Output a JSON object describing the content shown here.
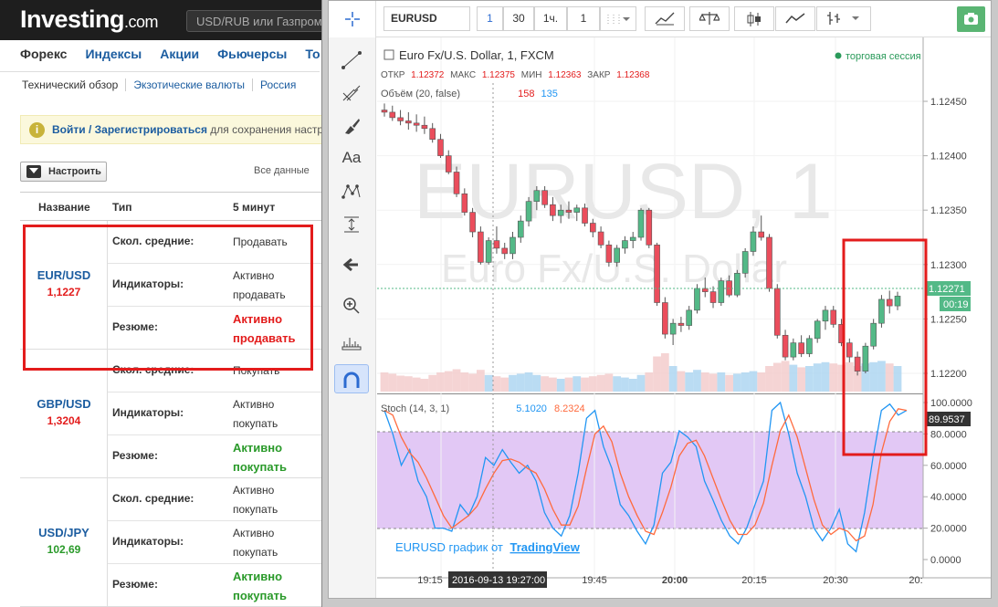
{
  "site": {
    "logo_main": "Investing",
    "logo_suffix": ".com",
    "search_placeholder": "USD/RUB или Газпром",
    "nav": [
      "Форекс",
      "Индексы",
      "Акции",
      "Фьючерсы",
      "То"
    ],
    "sub_nav": [
      "Технический обзор",
      "Экзотические валюты",
      "Россия"
    ],
    "banner": {
      "login": "Войти",
      "sep": " / ",
      "register": "Зарегистрироваться",
      "rest": " для сохранения настр"
    },
    "configure_label": "Настроить",
    "all_data_label": "Все данные",
    "table_headers": {
      "name": "Название",
      "type": "Тип",
      "interval": "5 минут"
    },
    "pairs": [
      {
        "name": "EUR/USD",
        "price": "1,1227",
        "price_color": "#e31c1c",
        "rows": [
          {
            "label": "Скол. средние:",
            "value": "Продавать"
          },
          {
            "label": "Индикаторы:",
            "value": "Активно продавать"
          },
          {
            "label": "Резюме:",
            "value": "Активно продавать"
          }
        ]
      },
      {
        "name": "GBP/USD",
        "price": "1,3204",
        "price_color": "#e31c1c",
        "rows": [
          {
            "label": "Скол. средние:",
            "value": "Покупать"
          },
          {
            "label": "Индикаторы:",
            "value": "Активно покупать"
          },
          {
            "label": "Резюме:",
            "value": "Активно покупать"
          }
        ]
      },
      {
        "name": "USD/JPY",
        "price": "102,69",
        "price_color": "#2a9a2a",
        "rows": [
          {
            "label": "Скол. средние:",
            "value": "Активно покупать"
          },
          {
            "label": "Индикаторы:",
            "value": "Активно покупать"
          },
          {
            "label": "Резюме:",
            "value": "Активно покупать"
          }
        ]
      }
    ]
  },
  "chart_window": {
    "symbol": "EURUSD",
    "intervals": [
      "1",
      "30",
      "1ч.",
      "1"
    ],
    "legend": {
      "title": "Euro Fx/U.S. Dollar, 1, FXCM",
      "open_prefix": "ОТКР",
      "open": "1.12372",
      "high_label": "МАКС",
      "high": "1.12375",
      "low_label": "МИН",
      "low": "1.12363",
      "close_label": "ЗАКР",
      "close": "1.12368"
    },
    "session_label": "торговая сессия",
    "volume_label": "Объём (20, false)",
    "volume_values": [
      "158",
      "135"
    ],
    "watermark_symbol": "EURUSD, 1",
    "watermark_name": "Euro Fx/U.S. Dollar",
    "stoch_label": "Stoch (14, 3, 1)",
    "stoch_values": [
      "5.1020",
      "8.2324"
    ],
    "attribution_prefix": "EURUSD график от",
    "attribution_link": "TradingView",
    "price_axis": [
      "1.12450",
      "1.12400",
      "1.12350",
      "1.12300",
      "1.12250",
      "1.12200"
    ],
    "current_price": "1.12271",
    "countdown": "00:19",
    "stoch_axis": [
      "100.0000",
      "80.0000",
      "60.0000",
      "40.0000",
      "20.0000",
      "0.0000"
    ],
    "stoch_current": "89.9537",
    "time_axis": [
      "19:15",
      "19:45",
      "20:00",
      "20:15",
      "20:30",
      "20:"
    ],
    "crosshair_time": "2016-09-13 19:27:00",
    "colors": {
      "up": "#53b987",
      "down": "#eb4d5c",
      "stoch_k": "#2196f3",
      "stoch_d": "#ff6a3d",
      "band": "#e2c8f5"
    }
  },
  "chart_data": [
    {
      "type": "candlestick",
      "title": "Euro Fx/U.S. Dollar, 1, FXCM",
      "ylim": [
        1.1218,
        1.1247
      ],
      "candles": [
        [
          1.12442,
          1.12448,
          1.12436,
          1.1244
        ],
        [
          1.1244,
          1.12446,
          1.12432,
          1.12435
        ],
        [
          1.12435,
          1.12442,
          1.12428,
          1.12432
        ],
        [
          1.12432,
          1.1244,
          1.12424,
          1.1243
        ],
        [
          1.1243,
          1.12438,
          1.12422,
          1.12428
        ],
        [
          1.12428,
          1.12436,
          1.1242,
          1.12425
        ],
        [
          1.12425,
          1.1243,
          1.12412,
          1.12415
        ],
        [
          1.12415,
          1.1242,
          1.12398,
          1.124
        ],
        [
          1.124,
          1.12405,
          1.12383,
          1.12385
        ],
        [
          1.12385,
          1.1239,
          1.12362,
          1.12365
        ],
        [
          1.12365,
          1.1237,
          1.12345,
          1.12348
        ],
        [
          1.12348,
          1.12352,
          1.12325,
          1.1233
        ],
        [
          1.1233,
          1.12335,
          1.123,
          1.12302
        ],
        [
          1.12302,
          1.12325,
          1.123,
          1.12322
        ],
        [
          1.12322,
          1.12335,
          1.1231,
          1.12315
        ],
        [
          1.12315,
          1.1232,
          1.12305,
          1.1231
        ],
        [
          1.1231,
          1.1233,
          1.12305,
          1.12325
        ],
        [
          1.12325,
          1.12345,
          1.1232,
          1.1234
        ],
        [
          1.1234,
          1.12362,
          1.12335,
          1.12358
        ],
        [
          1.12358,
          1.12372,
          1.1235,
          1.12368
        ],
        [
          1.12368,
          1.12372,
          1.12352,
          1.12355
        ],
        [
          1.12355,
          1.12362,
          1.1234,
          1.12345
        ],
        [
          1.12345,
          1.12355,
          1.12338,
          1.1235
        ],
        [
          1.1235,
          1.12358,
          1.12342,
          1.12348
        ],
        [
          1.12348,
          1.12355,
          1.1234,
          1.12352
        ],
        [
          1.12352,
          1.12356,
          1.12335,
          1.12338
        ],
        [
          1.12338,
          1.12342,
          1.12325,
          1.1233
        ],
        [
          1.1233,
          1.12335,
          1.12315,
          1.12318
        ],
        [
          1.12318,
          1.12322,
          1.12298,
          1.12302
        ],
        [
          1.12302,
          1.12318,
          1.12298,
          1.12315
        ],
        [
          1.12315,
          1.12326,
          1.1231,
          1.12322
        ],
        [
          1.12322,
          1.1233,
          1.12315,
          1.12325
        ],
        [
          1.12325,
          1.12352,
          1.12322,
          1.1235
        ],
        [
          1.1235,
          1.12352,
          1.12315,
          1.12318
        ],
        [
          1.12318,
          1.1232,
          1.12262,
          1.12265
        ],
        [
          1.12265,
          1.1227,
          1.12232,
          1.12236
        ],
        [
          1.12236,
          1.1225,
          1.12226,
          1.12246
        ],
        [
          1.12246,
          1.12252,
          1.12238,
          1.12244
        ],
        [
          1.12244,
          1.12262,
          1.1224,
          1.12258
        ],
        [
          1.12258,
          1.12282,
          1.12255,
          1.12278
        ],
        [
          1.12278,
          1.12288,
          1.1227,
          1.12275
        ],
        [
          1.12275,
          1.1228,
          1.1226,
          1.12265
        ],
        [
          1.12265,
          1.12288,
          1.12262,
          1.12285
        ],
        [
          1.12285,
          1.1229,
          1.1227,
          1.12272
        ],
        [
          1.12272,
          1.12295,
          1.1227,
          1.12292
        ],
        [
          1.12292,
          1.12315,
          1.12288,
          1.12312
        ],
        [
          1.12312,
          1.12335,
          1.12308,
          1.1233
        ],
        [
          1.1233,
          1.12345,
          1.12322,
          1.12325
        ],
        [
          1.12325,
          1.12328,
          1.12275,
          1.12278
        ],
        [
          1.12278,
          1.12282,
          1.12232,
          1.12235
        ],
        [
          1.12235,
          1.1224,
          1.12212,
          1.12215
        ],
        [
          1.12215,
          1.12232,
          1.12212,
          1.12228
        ],
        [
          1.12228,
          1.12235,
          1.12215,
          1.12218
        ],
        [
          1.12218,
          1.12235,
          1.12215,
          1.12232
        ],
        [
          1.12232,
          1.1225,
          1.12228,
          1.12248
        ],
        [
          1.12248,
          1.12262,
          1.1224,
          1.12258
        ],
        [
          1.12258,
          1.12262,
          1.12242,
          1.12245
        ],
        [
          1.12245,
          1.1225,
          1.12225,
          1.12228
        ],
        [
          1.12228,
          1.12232,
          1.1221,
          1.12215
        ],
        [
          1.12215,
          1.1222,
          1.12198,
          1.12202
        ],
        [
          1.12202,
          1.12228,
          1.122,
          1.12225
        ],
        [
          1.12225,
          1.1225,
          1.12222,
          1.12246
        ],
        [
          1.12246,
          1.12272,
          1.12242,
          1.12268
        ],
        [
          1.12268,
          1.12276,
          1.12255,
          1.12262
        ],
        [
          1.12262,
          1.12275,
          1.12258,
          1.12271
        ]
      ],
      "volumes": [
        30,
        28,
        25,
        24,
        22,
        20,
        26,
        30,
        32,
        35,
        30,
        28,
        34,
        26,
        24,
        22,
        26,
        28,
        30,
        26,
        24,
        22,
        20,
        22,
        24,
        22,
        24,
        26,
        28,
        24,
        22,
        20,
        26,
        30,
        55,
        60,
        40,
        32,
        30,
        34,
        30,
        28,
        30,
        26,
        28,
        30,
        32,
        30,
        40,
        45,
        48,
        42,
        38,
        40,
        44,
        46,
        44,
        42,
        46,
        40,
        44,
        46,
        48,
        44,
        40
      ]
    },
    {
      "type": "line",
      "title": "Stoch (14, 3, 1)",
      "ylim": [
        0,
        100
      ],
      "series": [
        {
          "name": "K",
          "values": [
            95,
            80,
            60,
            70,
            50,
            40,
            20,
            20,
            18,
            35,
            28,
            40,
            65,
            60,
            70,
            62,
            55,
            60,
            50,
            30,
            20,
            15,
            28,
            55,
            90,
            95,
            72,
            58,
            35,
            28,
            18,
            10,
            22,
            55,
            62,
            82,
            78,
            72,
            50,
            38,
            25,
            15,
            10,
            20,
            35,
            50,
            95,
            100,
            80,
            55,
            40,
            20,
            12,
            20,
            32,
            10,
            5,
            30,
            65,
            95,
            99,
            92,
            95
          ]
        },
        {
          "name": "D",
          "values": [
            95,
            92,
            78,
            68,
            62,
            52,
            40,
            28,
            20,
            24,
            28,
            34,
            45,
            55,
            63,
            64,
            62,
            58,
            55,
            45,
            32,
            22,
            22,
            34,
            58,
            80,
            85,
            75,
            55,
            40,
            28,
            18,
            16,
            30,
            46,
            66,
            74,
            76,
            66,
            52,
            38,
            25,
            16,
            16,
            22,
            36,
            60,
            82,
            92,
            78,
            58,
            38,
            22,
            16,
            20,
            18,
            12,
            15,
            35,
            68,
            88,
            96,
            95
          ]
        }
      ]
    }
  ]
}
